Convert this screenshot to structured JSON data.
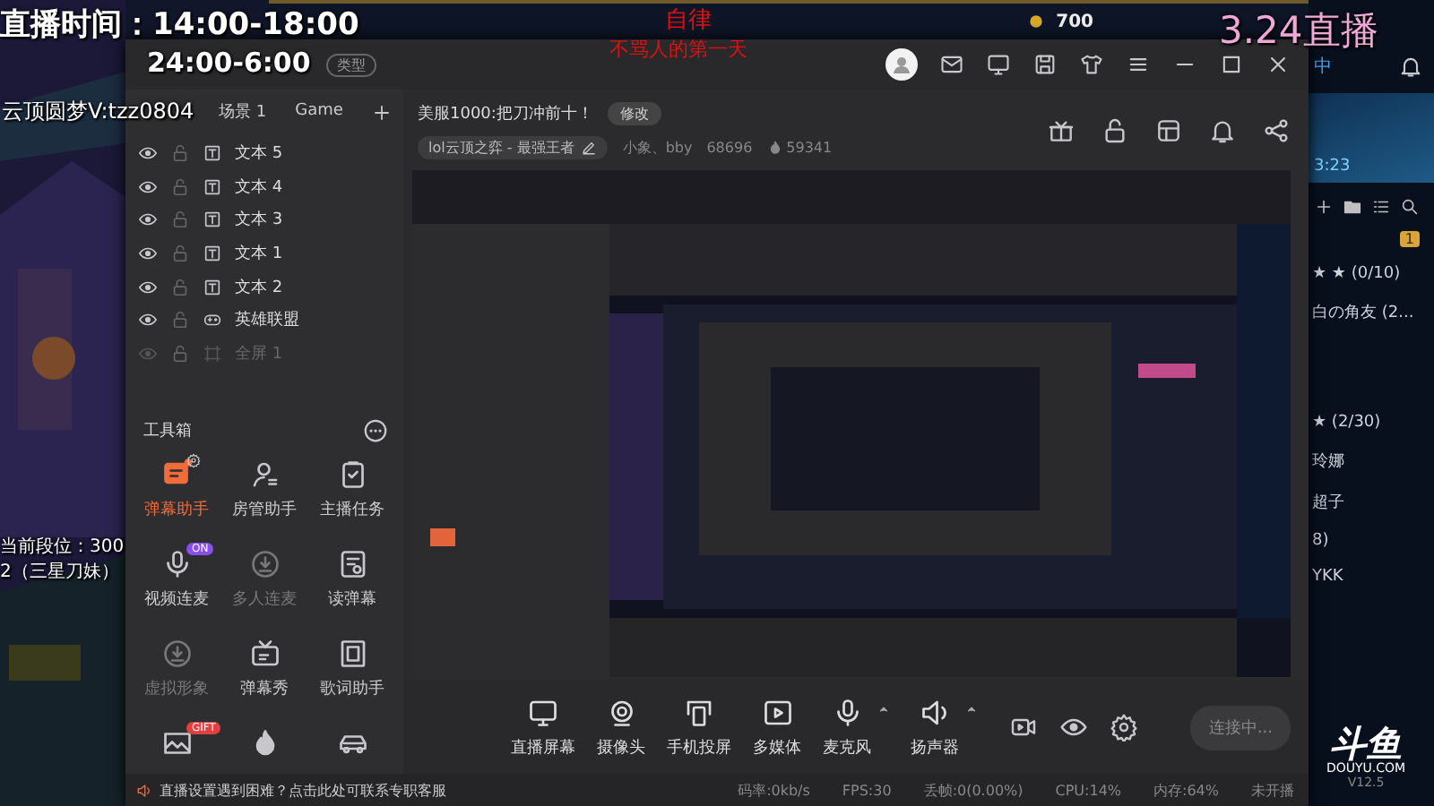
{
  "overlays": {
    "schedule": "直播时间：14:00-18:00",
    "night": "24:00-6:00",
    "contact": "云顶圆梦V:tzz0804",
    "motto": "自律",
    "motto_sub": "不骂人的第一天",
    "stream_date": "3.24直播",
    "rank": "当前段位：300",
    "hero": "2（三星刀妹）"
  },
  "game_bar": {
    "coins": "700"
  },
  "side_panel": {
    "status": "中",
    "time": "3:23",
    "badge": "1",
    "entries": [
      "★ ★ (0/10)",
      "白の角友 (2...",
      "★ (2/30)",
      "玲娜",
      "超子",
      "8)",
      "YKK"
    ]
  },
  "brand": {
    "logo": "斗鱼",
    "site": "DOUYU.COM",
    "version": "V12.5"
  },
  "window": {
    "type_badge": "类型",
    "scene_tabs": [
      {
        "label": "场景 1",
        "selected": false
      },
      {
        "label": "Game",
        "selected": false
      }
    ],
    "layers": [
      {
        "kind": "text",
        "label": "文本 5",
        "visible": true
      },
      {
        "kind": "text",
        "label": "文本 4",
        "visible": true
      },
      {
        "kind": "text",
        "label": "文本 3",
        "visible": true
      },
      {
        "kind": "text",
        "label": "文本 1",
        "visible": true
      },
      {
        "kind": "text",
        "label": "文本 2",
        "visible": true
      },
      {
        "kind": "game",
        "label": "英雄联盟",
        "visible": true
      },
      {
        "kind": "fullscreen",
        "label": "全屏 1",
        "visible": false
      }
    ],
    "toolbox_title": "工具箱",
    "tools": [
      {
        "label": "弹幕助手",
        "selected": true,
        "disabled": false
      },
      {
        "label": "房管助手",
        "selected": false,
        "disabled": false
      },
      {
        "label": "主播任务",
        "selected": false,
        "disabled": false
      },
      {
        "label": "视频连麦",
        "selected": false,
        "disabled": false,
        "badge": "ON"
      },
      {
        "label": "多人连麦",
        "selected": false,
        "disabled": true
      },
      {
        "label": "读弹幕",
        "selected": false,
        "disabled": false
      },
      {
        "label": "虚拟形象",
        "selected": false,
        "disabled": true
      },
      {
        "label": "弹幕秀",
        "selected": false,
        "disabled": false
      },
      {
        "label": "歌词助手",
        "selected": false,
        "disabled": false
      },
      {
        "selected": false,
        "disabled": false,
        "badge": "GIFT"
      },
      {
        "selected": false,
        "disabled": false
      },
      {
        "selected": false,
        "disabled": false
      }
    ],
    "notice": "直播设置遇到困难？点击此处可联系专职客服",
    "stream_title": "美服1000:把刀冲前十！",
    "edit_button": "修改",
    "category": "lol云顶之弈 - 最强王者",
    "host": "小象、bby",
    "room_id": "68696",
    "heat": "59341",
    "sources": [
      {
        "label": "直播屏幕",
        "caret": false
      },
      {
        "label": "摄像头",
        "caret": false
      },
      {
        "label": "手机投屏",
        "caret": false
      },
      {
        "label": "多媒体",
        "caret": false
      },
      {
        "label": "麦克风",
        "caret": true
      },
      {
        "label": "扬声器",
        "caret": true
      }
    ],
    "connect_button": "连接中...",
    "status_bar": [
      "码率:0kb/s",
      "FPS:30",
      "丢帧:0(0.00%)",
      "CPU:14%",
      "内存:64%",
      "未开播"
    ]
  }
}
